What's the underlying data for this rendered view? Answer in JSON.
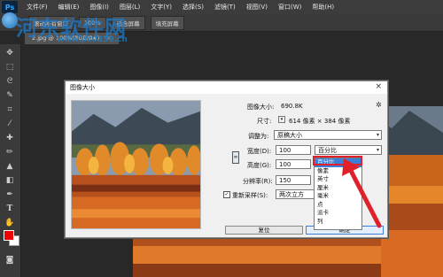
{
  "menubar": {
    "logo": "Ps",
    "items": [
      "文件(F)",
      "编辑(E)",
      "图像(I)",
      "图层(L)",
      "文字(Y)",
      "选择(S)",
      "滤镜(T)",
      "视图(V)",
      "窗口(W)",
      "帮助(H)"
    ]
  },
  "optbar": {
    "buttons": [
      "滚动所有窗口",
      "100%",
      "适合屏幕",
      "填充屏幕"
    ]
  },
  "document_tab": {
    "label": "2.jpg @ 100%(RGB/8#)",
    "close": "×"
  },
  "watermark": {
    "title": "河东软件网",
    "url": "www.pc0359.cn"
  },
  "dialog": {
    "title": "图像大小",
    "close": "×",
    "image_size_label": "图像大小:",
    "image_size_value": "690.8K",
    "dimensions_label": "尺寸:",
    "dimensions_value": "614 像素 × 384 像素",
    "fit_label": "调整为:",
    "fit_value": "原稿大小",
    "width_label": "宽度(D):",
    "width_value": "100",
    "height_label": "高度(G):",
    "height_value": "100",
    "resolution_label": "分辨率(R):",
    "resolution_value": "150",
    "resample_label": "重新采样(S):",
    "resample_value": "两次立方（平",
    "unit_selected": "百分比",
    "unit_options": [
      "百分比",
      "像素",
      "英寸",
      "厘米",
      "毫米",
      "点",
      "派卡",
      "列"
    ],
    "reset_label": "复位",
    "ok_label": "确定"
  },
  "colors": {
    "foreground": "#e00000",
    "background": "#ffffff",
    "annotation": "#e0202a",
    "selection": "#3b7fd9"
  }
}
